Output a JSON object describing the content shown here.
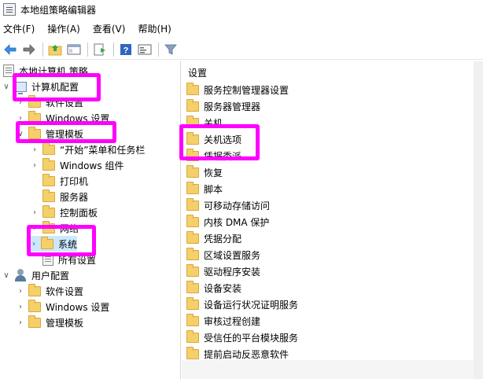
{
  "window": {
    "title": "本地组策略编辑器"
  },
  "menu": [
    {
      "label": "文件(F)"
    },
    {
      "label": "操作(A)"
    },
    {
      "label": "查看(V)"
    },
    {
      "label": "帮助(H)"
    }
  ],
  "tree": {
    "root": "本地计算机 策略",
    "computer_config": "计算机配置",
    "software_settings": "软件设置",
    "windows_settings": "Windows 设置",
    "admin_templates": "管理模板",
    "start_menu": "“开始”菜单和任务栏",
    "windows_components": "Windows 组件",
    "printers": "打印机",
    "servers": "服务器",
    "control_panel": "控制面板",
    "network": "网络",
    "system": "系统",
    "all_settings": "所有设置",
    "user_config": "用户配置",
    "user_software_settings": "软件设置",
    "user_windows_settings": "Windows 设置",
    "user_admin_templates": "管理模板"
  },
  "right": {
    "header": "设置",
    "items": [
      "服务控制管理器设置",
      "服务器管理器",
      "关机",
      "关机选项",
      "凭据委派",
      "恢复",
      "脚本",
      "可移动存储访问",
      "内核 DMA 保护",
      "凭据分配",
      "区域设置服务",
      "驱动程序安装",
      "设备安装",
      "设备运行状况证明服务",
      "审核过程创建",
      "受信任的平台模块服务",
      "提前启动反恶意软件"
    ]
  },
  "colors": {
    "highlight": "#ff00ff",
    "folder": "#f5cf6a",
    "selection": "#cce8ff"
  }
}
